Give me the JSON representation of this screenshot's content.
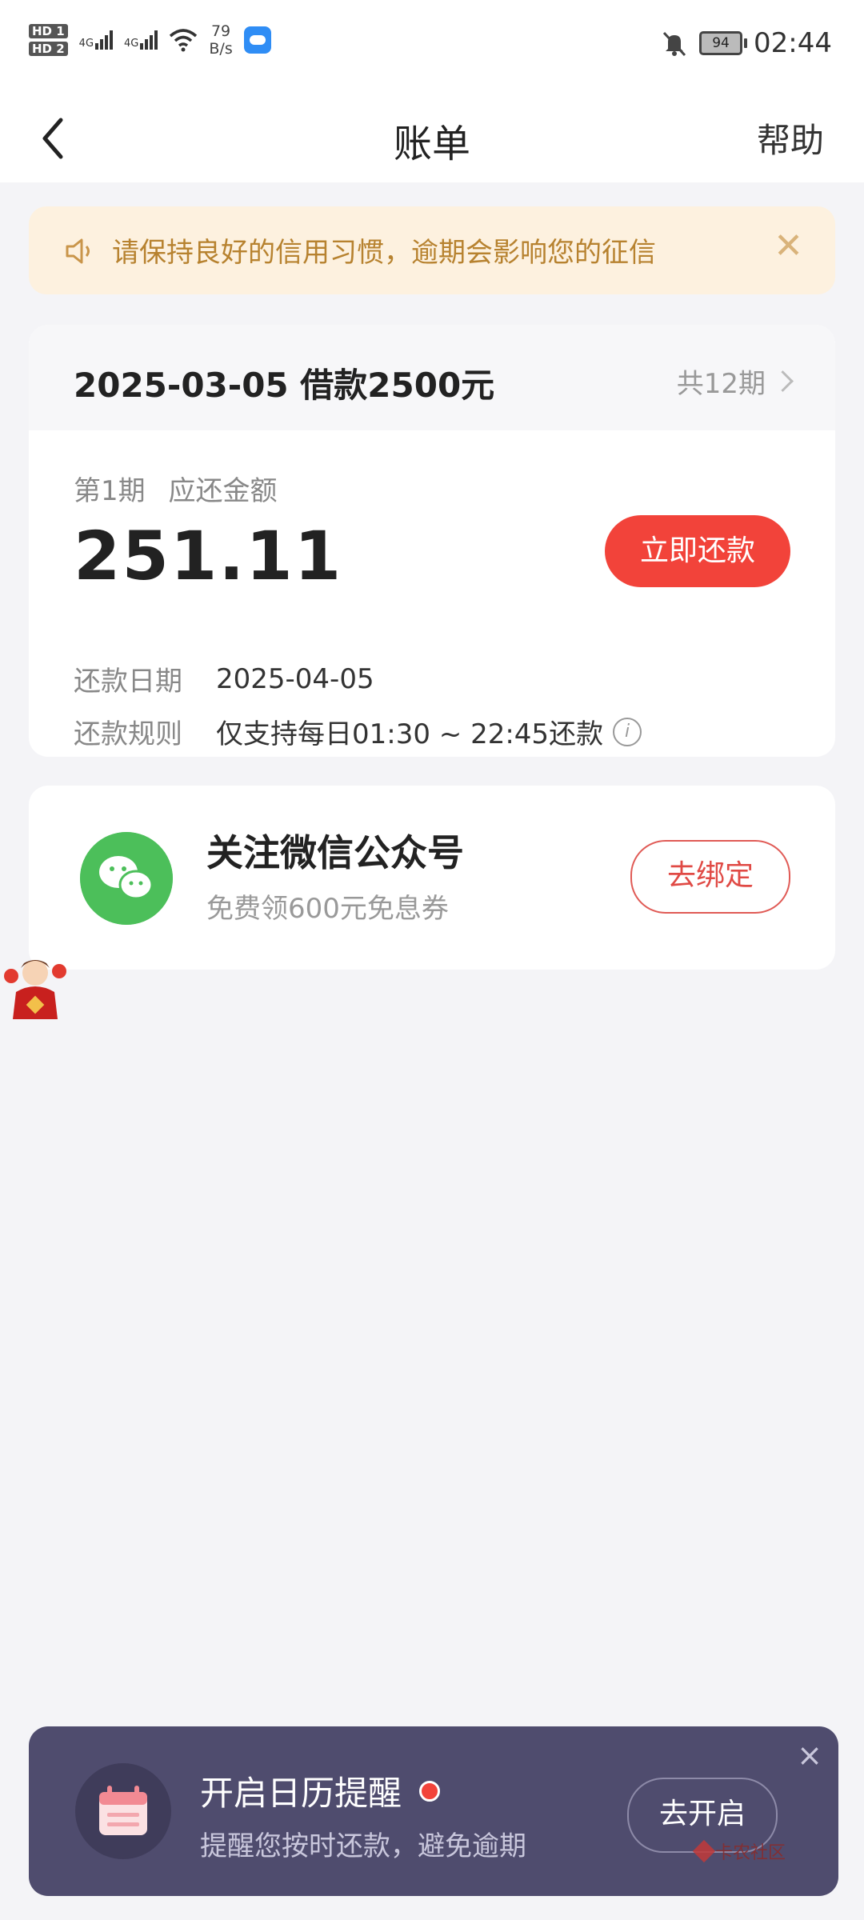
{
  "status_bar": {
    "hd1": "HD 1",
    "hd2": "HD 2",
    "net1": "4G",
    "net2": "4G",
    "speed_value": "79",
    "speed_unit": "B/s",
    "battery": "94",
    "time": "02:44"
  },
  "nav": {
    "title": "账单",
    "help": "帮助"
  },
  "notice": {
    "text": "请保持良好的信用习惯，逾期会影响您的征信"
  },
  "loan": {
    "date": "2025-03-05",
    "amount_label": "借款2500元",
    "periods": "共12期",
    "period_label": "第1期",
    "due_label": "应还金额",
    "due_amount": "251.11",
    "pay_button": "立即还款",
    "repay_date_key": "还款日期",
    "repay_date": "2025-04-05",
    "rule_key": "还款规则",
    "rule_value": "仅支持每日01:30 ~ 22:45还款",
    "info_icon": "i"
  },
  "wechat": {
    "title": "关注微信公众号",
    "subtitle": "免费领600元免息券",
    "button": "去绑定"
  },
  "reminder": {
    "title": "开启日历提醒",
    "subtitle": "提醒您按时还款，避免逾期",
    "button": "去开启",
    "close": "×"
  },
  "watermark": "卡农社区",
  "colors": {
    "accent_red": "#f2433a",
    "notice_bg": "#fdf1df",
    "notice_text": "#b7822f",
    "wechat_green": "#4cbf5a",
    "reminder_bg": "#4f4c6e"
  }
}
